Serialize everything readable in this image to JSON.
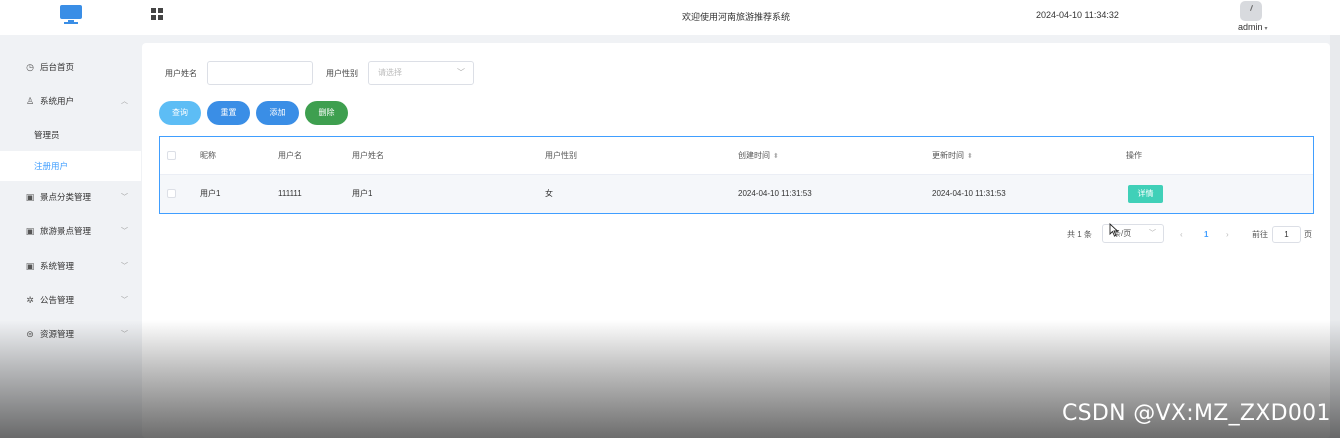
{
  "header": {
    "welcome": "欢迎使用河南旅游推荐系统",
    "datetime": "2024-04-10 11:34:32",
    "username": "admin"
  },
  "sidebar": {
    "items": [
      {
        "icon": "clock-icon",
        "glyph": "◷",
        "label": "后台首页"
      },
      {
        "icon": "user-icon",
        "glyph": "♙",
        "label": "系统用户",
        "expanded": true,
        "children": [
          {
            "label": "管理员"
          },
          {
            "label": "注册用户",
            "active": true
          }
        ]
      },
      {
        "icon": "picture-icon",
        "glyph": "▣",
        "label": "景点分类管理"
      },
      {
        "icon": "picture-icon",
        "glyph": "▣",
        "label": "旅游景点管理"
      },
      {
        "icon": "settings-box-icon",
        "glyph": "▣",
        "label": "系统管理"
      },
      {
        "icon": "announcement-icon",
        "glyph": "✲",
        "label": "公告管理"
      },
      {
        "icon": "resource-icon",
        "glyph": "⊜",
        "label": "资源管理"
      }
    ]
  },
  "search": {
    "name_label": "用户姓名",
    "name_value": "",
    "gender_label": "用户性别",
    "gender_placeholder": "请选择"
  },
  "buttons": {
    "query": "查询",
    "reset": "重置",
    "add": "添加",
    "delete": "删除"
  },
  "colors": {
    "query": "#5dbdf5",
    "reset": "#3a8ee6",
    "add": "#3a8ee6",
    "delete": "#3e9f4f",
    "detail": "#40d0b8",
    "accent": "#409eff"
  },
  "table": {
    "headers": [
      "昵称",
      "用户名",
      "用户姓名",
      "用户性别",
      "创建时间",
      "更新时间",
      "操作"
    ],
    "rows": [
      {
        "nickname": "用户1",
        "username": "111111",
        "realname": "用户1",
        "gender": "女",
        "created": "2024-04-10 11:31:53",
        "updated": "2024-04-10 11:31:53",
        "action": "详情"
      }
    ]
  },
  "pagination": {
    "total": "共 1 条",
    "page_size": "条/页",
    "prev": "‹",
    "current": "1",
    "next": "›",
    "goto_label": "前往",
    "goto_value": "1",
    "page_unit": "页"
  },
  "watermark": "CSDN @VX:MZ_ZXD001"
}
